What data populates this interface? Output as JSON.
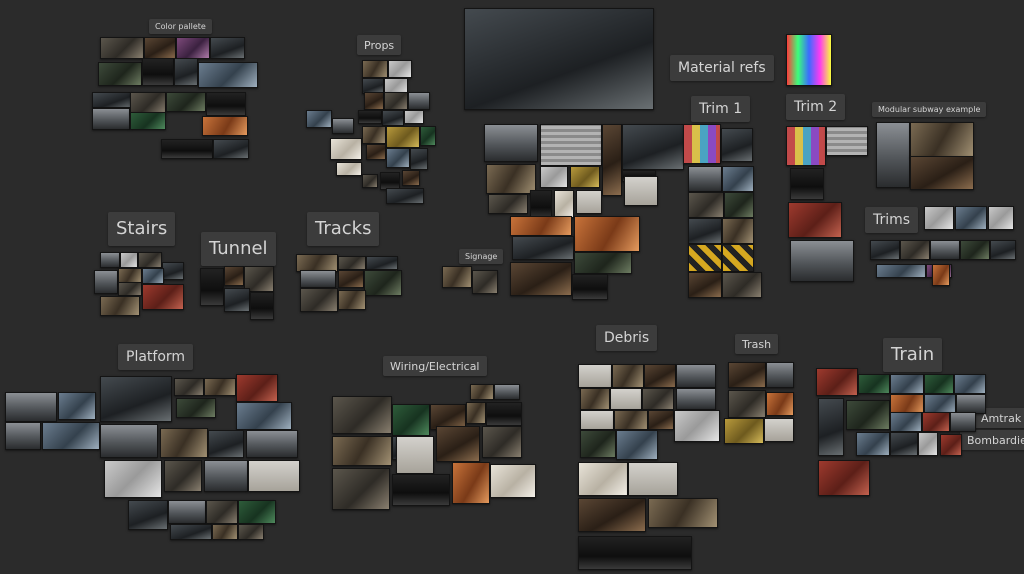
{
  "board": {
    "labels": {
      "color_pallete": "Color pallete",
      "props": "Props",
      "material_refs": "Material refs",
      "trim1": "Trim 1",
      "trim2": "Trim 2",
      "modular_subway_example": "Modular subway example",
      "trims": "Trims",
      "stairs": "Stairs",
      "tunnel": "Tunnel",
      "tracks": "Tracks",
      "signage": "Signage",
      "platform": "Platform",
      "wiring_electrical": "Wiring/Electrical",
      "debris": "Debris",
      "trash": "Trash",
      "train": "Train",
      "amtrak": "Amtrak",
      "bombardier": "Bombardier"
    }
  }
}
